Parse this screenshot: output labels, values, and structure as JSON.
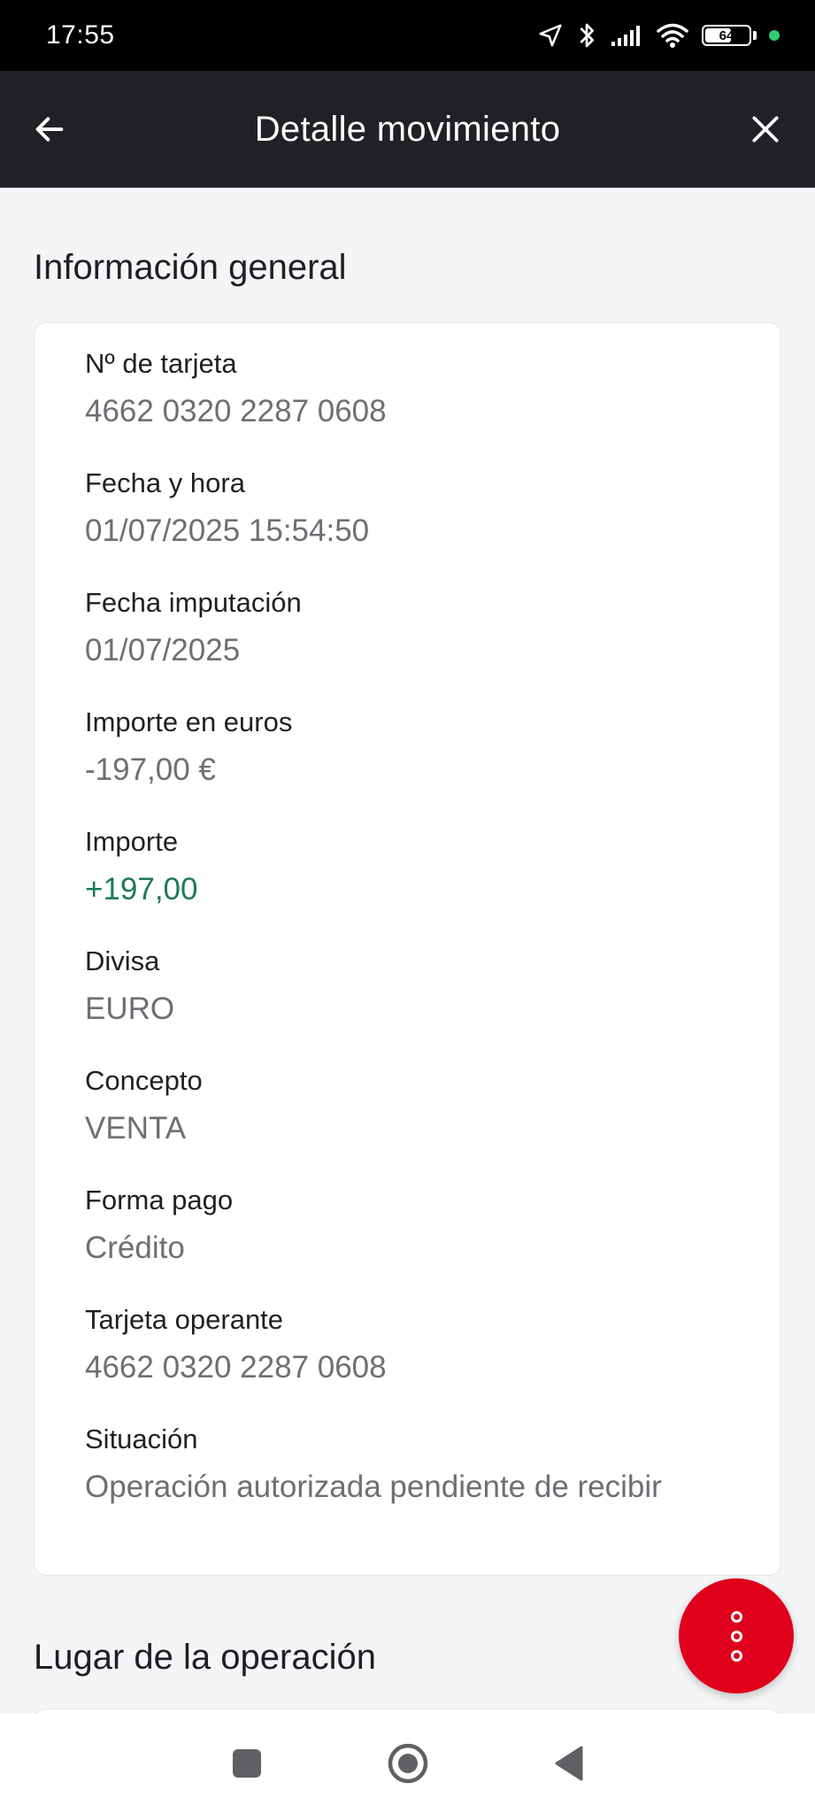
{
  "status_bar": {
    "time": "17:55",
    "battery": "64",
    "battery_level": 0.64,
    "icons": [
      "location-icon",
      "bluetooth-icon",
      "signal-icon",
      "wifi-icon",
      "battery-icon",
      "dot-icon"
    ]
  },
  "header": {
    "title": "Detalle movimiento",
    "back_icon": "arrow-left-icon",
    "close_icon": "close-icon"
  },
  "general": {
    "title": "Información general",
    "fields": [
      {
        "label": "Nº de tarjeta",
        "value": "4662 0320 2287 0608"
      },
      {
        "label": "Fecha y hora",
        "value": "01/07/2025 15:54:50"
      },
      {
        "label": "Fecha imputación",
        "value": "01/07/2025"
      },
      {
        "label": "Importe en euros",
        "value": "-197,00 €"
      },
      {
        "label": "Importe",
        "value": "+197,00"
      },
      {
        "label": "Divisa",
        "value": "EURO"
      },
      {
        "label": "Concepto",
        "value": "VENTA"
      },
      {
        "label": "Forma pago",
        "value": "Crédito"
      },
      {
        "label": "Tarjeta operante",
        "value": "4662 0320 2287 0608"
      },
      {
        "label": "Situación",
        "value": "Operación autorizada pendiente de recibir"
      }
    ]
  },
  "location": {
    "title": "Lugar de la operación"
  },
  "fab": {
    "icon": "more-vertical-icon"
  },
  "colors": {
    "header_bg": "#202124",
    "positive": "#1e7a5a",
    "fab": "#e0001b",
    "background": "#f4f5f7"
  },
  "nav_bar": {
    "icons": [
      "recents-icon",
      "home-icon",
      "back-icon"
    ]
  }
}
